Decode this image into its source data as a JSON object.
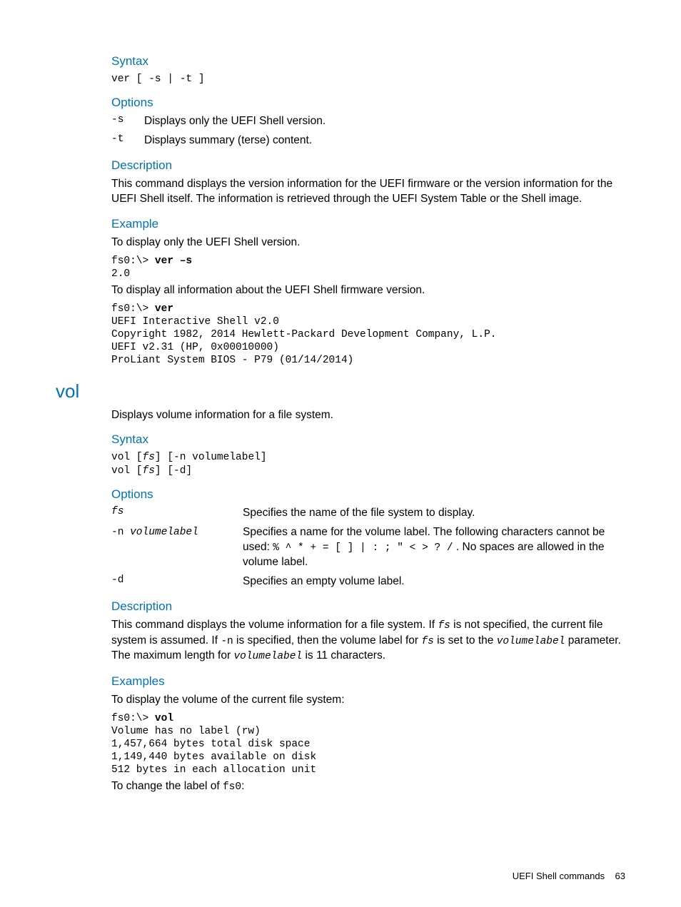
{
  "ver": {
    "syntax_h": "Syntax",
    "syntax_code": "ver [ -s | -t ]",
    "options_h": "Options",
    "opts": [
      {
        "key": "-s",
        "val": "Displays only the UEFI Shell version."
      },
      {
        "key": "-t",
        "val": "Displays summary (terse) content."
      }
    ],
    "desc_h": "Description",
    "desc": "This command displays the version information for the UEFI firmware or the version information for the UEFI Shell itself. The information is retrieved through the UEFI System Table or the Shell image.",
    "ex_h": "Example",
    "ex1_intro": "To display only the UEFI Shell version.",
    "ex1_prompt": "fs0:\\> ",
    "ex1_cmd": "ver –s",
    "ex1_out": "2.0",
    "ex2_intro": "To display all information about the UEFI Shell firmware version.",
    "ex2_prompt": "fs0:\\> ",
    "ex2_cmd": "ver",
    "ex2_out": "UEFI Interactive Shell v2.0\nCopyright 1982, 2014 Hewlett-Packard Development Company, L.P.\nUEFI v2.31 (HP, 0x00010000)\nProLiant System BIOS - P79 (01/14/2014)"
  },
  "vol": {
    "title": "vol",
    "intro": "Displays volume information for a file system.",
    "syntax_h": "Syntax",
    "syntax_l1a": "vol [",
    "syntax_l1b": "fs",
    "syntax_l1c": "] [-n volumelabel]",
    "syntax_l2a": "vol [",
    "syntax_l2b": "fs",
    "syntax_l2c": "] [-d]",
    "options_h": "Options",
    "optA_key": "fs",
    "optA_val": "Specifies the name of the file system to display.",
    "optB_key1": "-n ",
    "optB_key2": "volumelabel",
    "optB_val_pre": "Specifies a name for the volume label. The following characters cannot be used: ",
    "optB_val_mono": "% ^ * + = [ ] | : ; \" < > ? /",
    "optB_val_post": " . No spaces are allowed in the volume label.",
    "optC_key": "-d",
    "optC_val": "Specifies an empty volume label.",
    "desc_h": "Description",
    "desc_1": "This command displays the volume information for a file system. If ",
    "desc_fs": "fs",
    "desc_2": " is not specified, the current file system is assumed. If ",
    "desc_n": " -n",
    "desc_3": " is specified, then the volume label for ",
    "desc_4": " is set to the ",
    "desc_vl": "volumelabel",
    "desc_5": " parameter. The maximum length for ",
    "desc_6": " is 11 characters.",
    "ex_h": "Examples",
    "ex1_intro": "To display the volume of the current file system:",
    "ex1_prompt": "fs0:\\> ",
    "ex1_cmd": "vol",
    "ex1_out": "Volume has no label (rw)\n1,457,664 bytes total disk space\n1,149,440 bytes available on disk\n512 bytes in each allocation unit",
    "ex2_intro_pre": "To change the label of ",
    "ex2_intro_mono": "fs0",
    "ex2_intro_post": ":"
  },
  "footer": {
    "text": "UEFI Shell commands",
    "page": "63"
  }
}
